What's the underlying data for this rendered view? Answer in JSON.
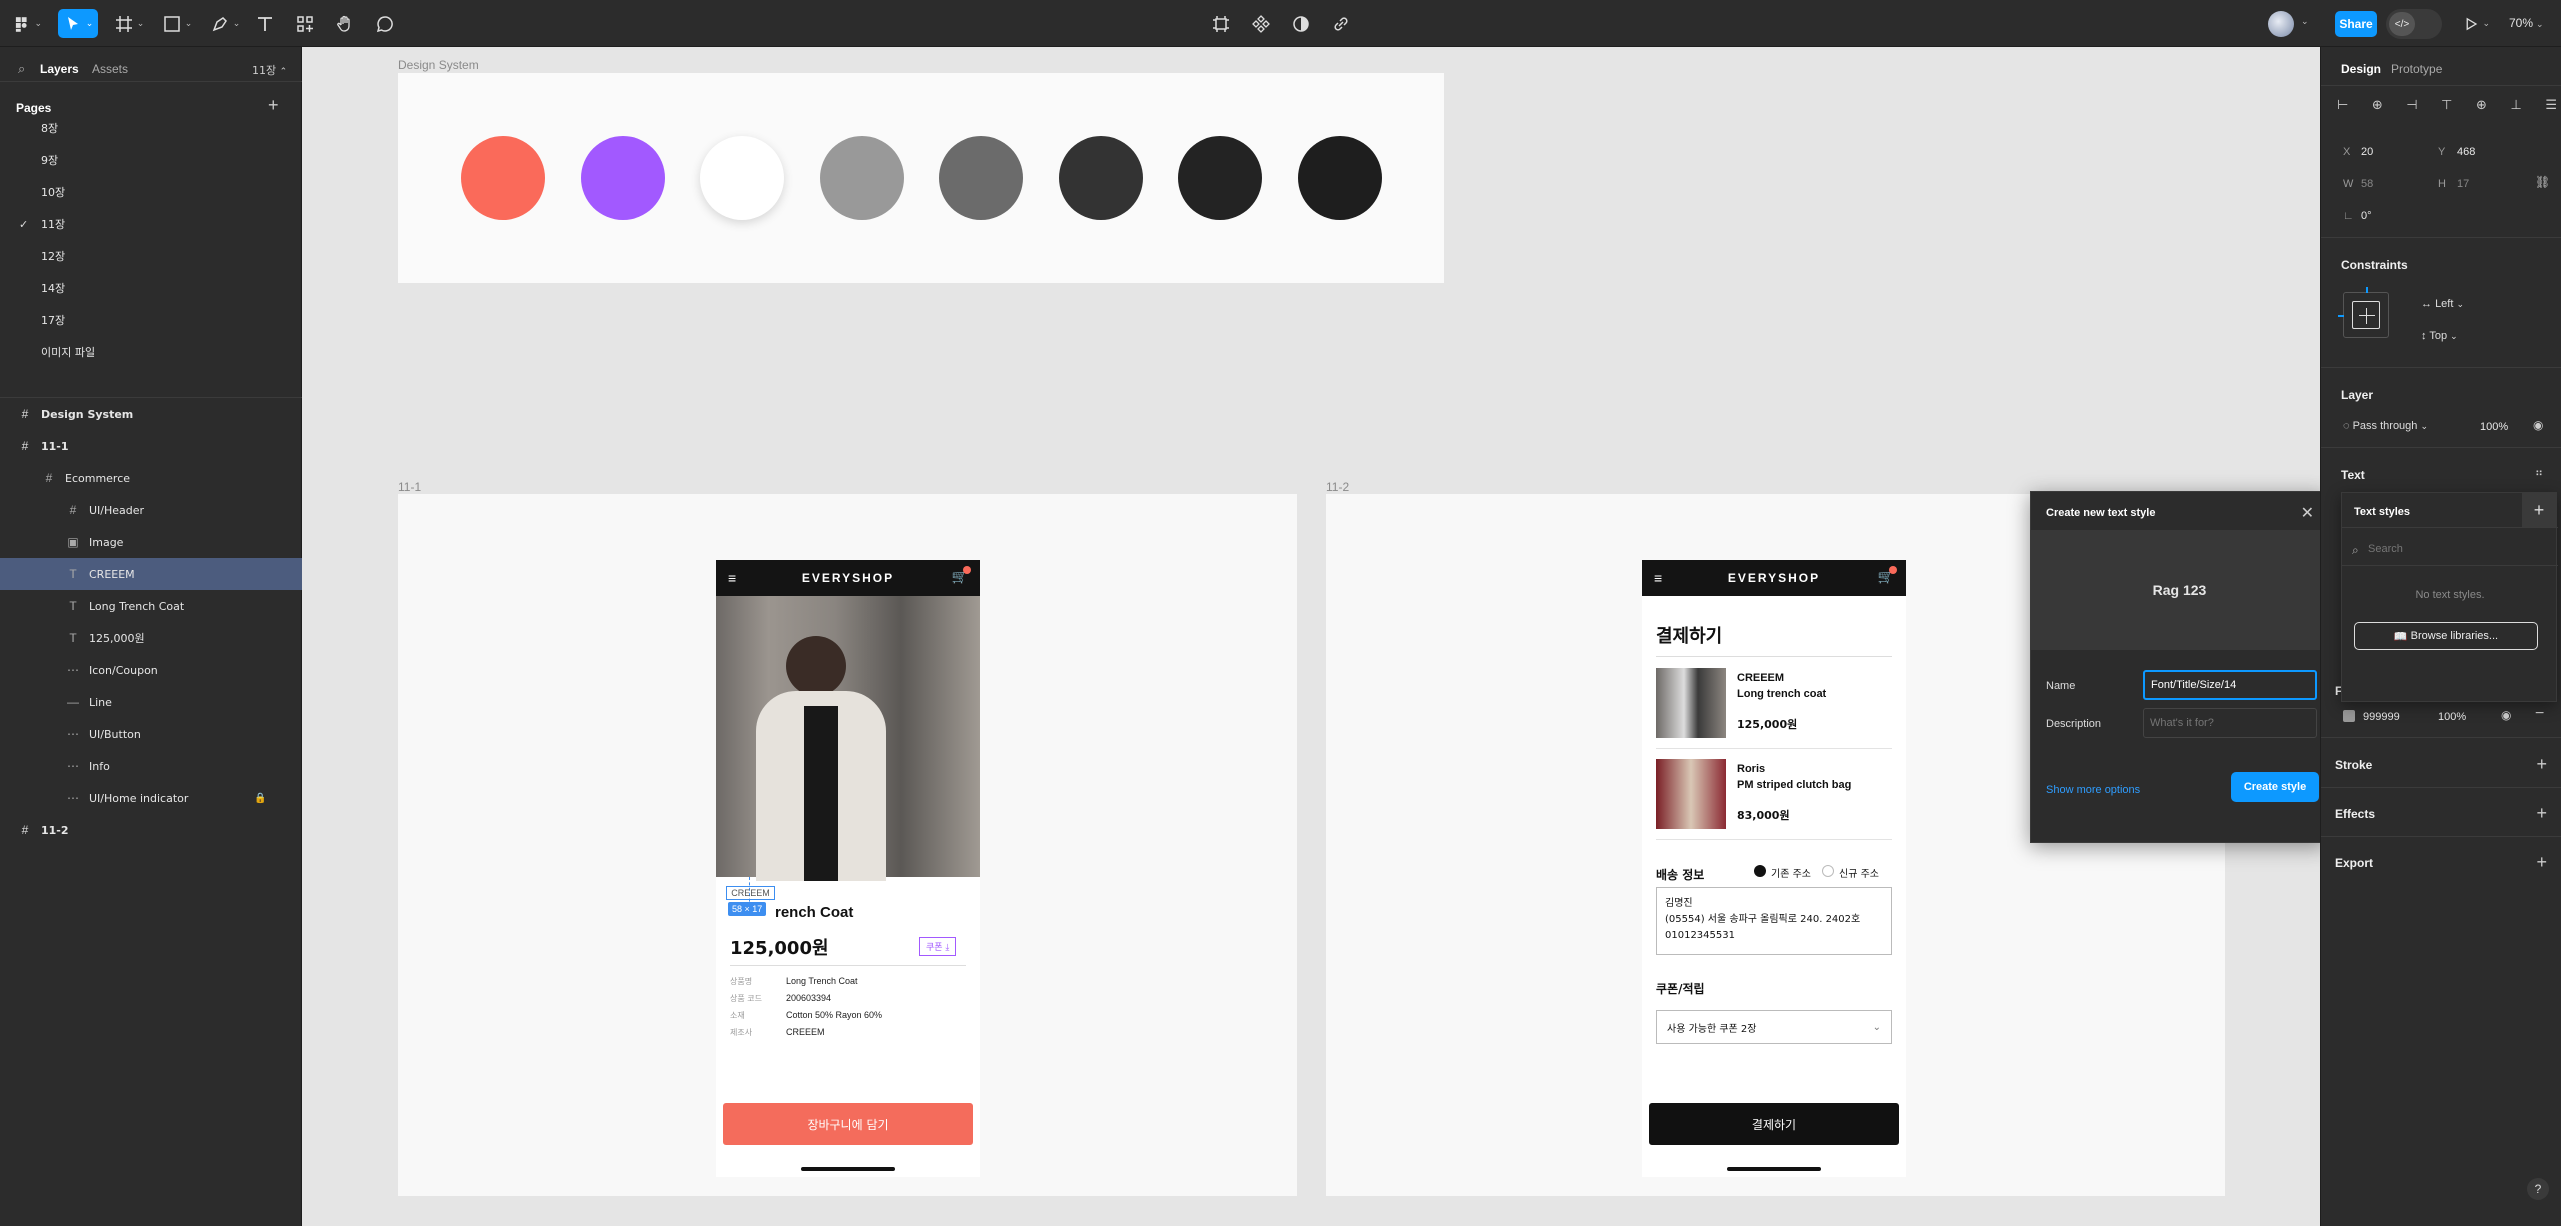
{
  "toolbar": {
    "share_label": "Share",
    "zoom": "70%"
  },
  "left_panel": {
    "tab_layers": "Layers",
    "tab_assets": "Assets",
    "page_selector": "11장",
    "pages_title": "Pages",
    "pages": [
      "8장",
      "9장",
      "10장",
      "11장",
      "12장",
      "14장",
      "17장",
      "이미지 파일"
    ],
    "current_page_index": 3,
    "layers": [
      {
        "label": "Design System",
        "indent": 0,
        "icon": "frame-icon",
        "bold": true
      },
      {
        "label": "11-1",
        "indent": 0,
        "icon": "frame-icon",
        "bold": true
      },
      {
        "label": "Ecommerce",
        "indent": 1,
        "icon": "frame-icon",
        "bold": false
      },
      {
        "label": "UI/Header",
        "indent": 2,
        "icon": "frame-icon",
        "bold": false
      },
      {
        "label": "Image",
        "indent": 2,
        "icon": "image-icon",
        "bold": false
      },
      {
        "label": "CREEEM",
        "indent": 2,
        "icon": "text-icon",
        "bold": false,
        "selected": true
      },
      {
        "label": "Long Trench Coat",
        "indent": 2,
        "icon": "text-icon",
        "bold": false
      },
      {
        "label": "125,000원",
        "indent": 2,
        "icon": "text-icon",
        "bold": false
      },
      {
        "label": "Icon/Coupon",
        "indent": 2,
        "icon": "group-icon",
        "bold": false
      },
      {
        "label": "Line",
        "indent": 2,
        "icon": "line-icon",
        "bold": false
      },
      {
        "label": "UI/Button",
        "indent": 2,
        "icon": "group-icon",
        "bold": false
      },
      {
        "label": "Info",
        "indent": 2,
        "icon": "group-icon",
        "bold": false
      },
      {
        "label": "UI/Home indicator",
        "indent": 2,
        "icon": "group-icon",
        "bold": false,
        "locked": true
      },
      {
        "label": "11-2",
        "indent": 0,
        "icon": "frame-icon",
        "bold": true
      }
    ]
  },
  "canvas": {
    "design_system_label": "Design System",
    "swatches": [
      "#fa6a5a",
      "#a259ff",
      "#ffffff",
      "#999999",
      "#6b6b6b",
      "#333333",
      "#232323",
      "#1e1e1e"
    ],
    "frame1_label": "11-1",
    "frame2_label": "11-2",
    "selection_size": "58 × 17",
    "selected_text": "CREEEM",
    "phone1": {
      "brand": "EVERYSHOP",
      "product_title": "rench Coat",
      "price": "125,000원",
      "coupon": "쿠폰",
      "info": [
        {
          "k": "상품명",
          "v": "Long Trench Coat"
        },
        {
          "k": "상품 코드",
          "v": "200603394"
        },
        {
          "k": "소재",
          "v": "Cotton 50% Rayon 60%"
        },
        {
          "k": "제조사",
          "v": "CREEEM"
        }
      ],
      "cart_button": "장바구니에 담기"
    },
    "phone2": {
      "brand": "EVERYSHOP",
      "title": "결제하기",
      "items": [
        {
          "brand": "CREEEM",
          "name": "Long trench coat",
          "price": "125,000원"
        },
        {
          "brand": "Roris",
          "name": "PM striped clutch bag",
          "price": "83,000원"
        }
      ],
      "shipping_title": "배송 정보",
      "addr_opt1": "기존 주소",
      "addr_opt2": "신규 주소",
      "address_lines": [
        "김명진",
        "(05554) 서울 송파구 올림픽로 240. 2402호",
        "01012345531"
      ],
      "coupon_title": "쿠폰/적립",
      "coupon_select": "사용 가능한 쿠폰 2장",
      "pay_button": "결제하기"
    }
  },
  "modal": {
    "title": "Create new text style",
    "preview": "Rag 123",
    "name_label": "Name",
    "name_value": "Font/Title/Size/14",
    "desc_label": "Description",
    "desc_placeholder": "What's it for?",
    "more_options": "Show more options",
    "create_button": "Create style"
  },
  "text_styles_popup": {
    "title": "Text styles",
    "search_placeholder": "Search",
    "empty": "No text styles.",
    "browse": "Browse libraries..."
  },
  "right_panel": {
    "tab_design": "Design",
    "tab_prototype": "Prototype",
    "x_label": "X",
    "x": "20",
    "y_label": "Y",
    "y": "468",
    "w_label": "W",
    "w": "58",
    "h_label": "H",
    "h": "17",
    "rotation": "0°",
    "constraints_title": "Constraints",
    "constraint_h": "Left",
    "constraint_v": "Top",
    "layer_title": "Layer",
    "blend": "Pass through",
    "opacity": "100%",
    "text_title": "Text",
    "fill_title": "Fill",
    "fill_hex": "999999",
    "fill_opacity": "100%",
    "stroke_title": "Stroke",
    "effects_title": "Effects",
    "export_title": "Export",
    "help": "?"
  }
}
